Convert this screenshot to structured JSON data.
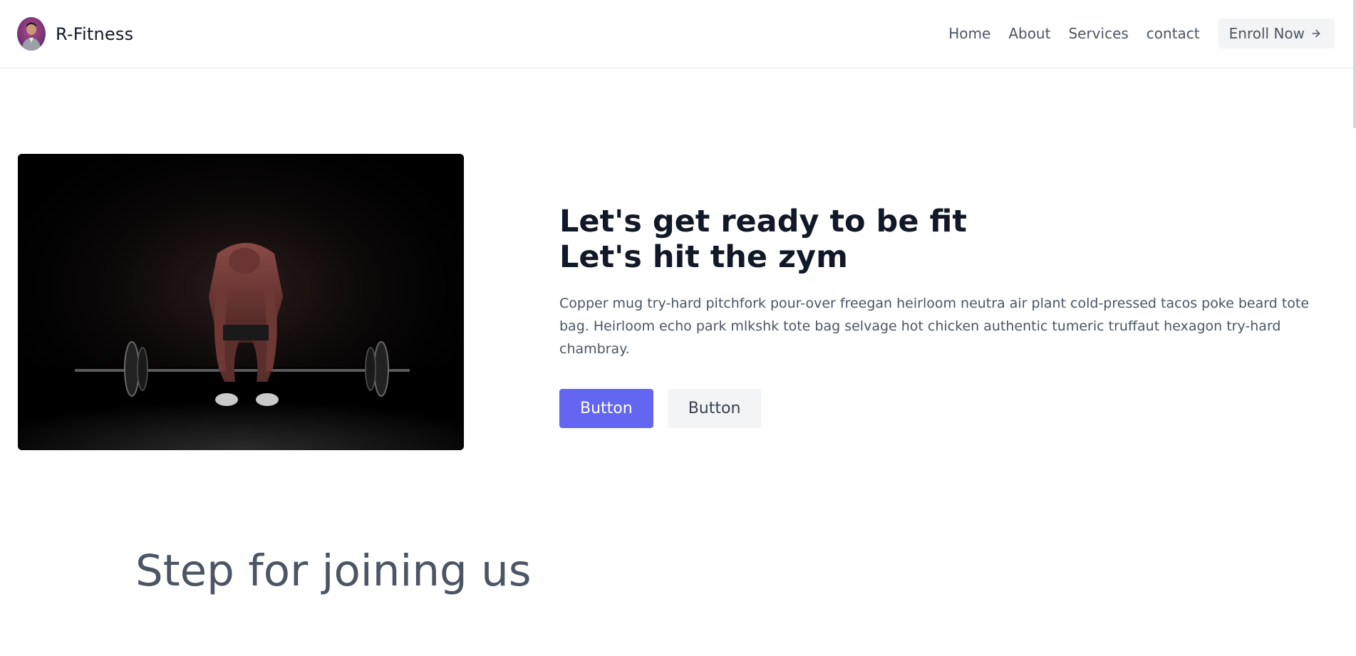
{
  "header": {
    "brand_name": "R-Fitness",
    "nav": [
      "Home",
      "About",
      "Services",
      "contact"
    ],
    "enroll_label": "Enroll Now"
  },
  "hero": {
    "title_line1": "Let's get ready to be fit",
    "title_line2": "Let's hit the zym",
    "description": "Copper mug try-hard pitchfork pour-over freegan heirloom neutra air plant cold-pressed tacos poke beard tote bag. Heirloom echo park mlkshk tote bag selvage hot chicken authentic tumeric truffaut hexagon try-hard chambray.",
    "primary_button": "Button",
    "secondary_button": "Button"
  },
  "section": {
    "title": "Step for joining us"
  },
  "colors": {
    "accent": "#6366f1",
    "secondary_button_bg": "#f3f4f6",
    "text_dark": "#111827",
    "text_muted": "#4b5563"
  },
  "icons": {
    "enroll": "arrow-right-icon",
    "avatar": "avatar-photo"
  }
}
